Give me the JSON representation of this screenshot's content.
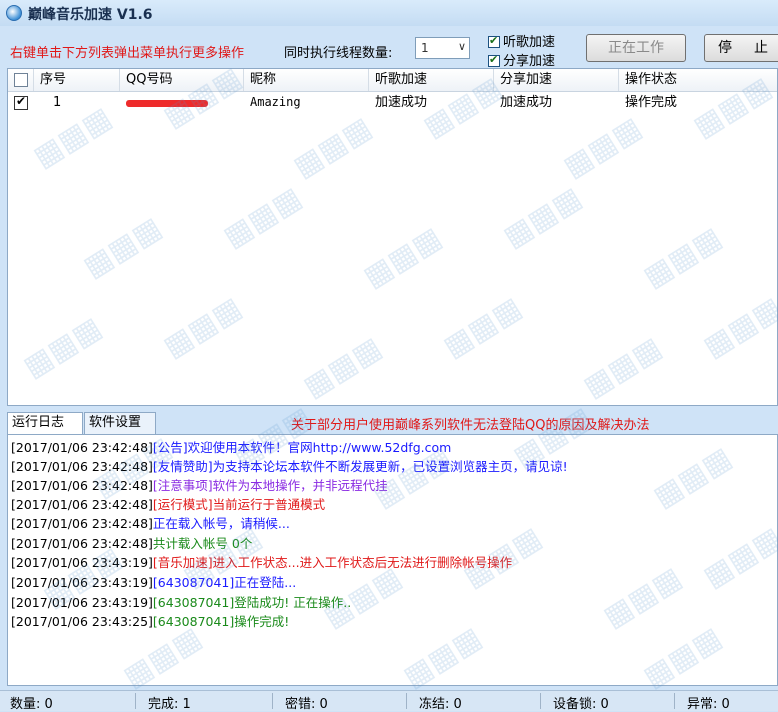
{
  "window": {
    "title": "巅峰音乐加速 V1.6"
  },
  "toolbar": {
    "hint": "右键单击下方列表弹出菜单执行更多操作",
    "threads_label": "同时执行线程数量:",
    "threads_value": "1",
    "listen_checkbox": "听歌加速",
    "share_checkbox": "分享加速",
    "working_button": "正在工作",
    "stop_button": "停止"
  },
  "table": {
    "columns": [
      "序号",
      "QQ号码",
      "昵称",
      "听歌加速",
      "分享加速",
      "操作状态"
    ],
    "rows": [
      {
        "index": "1",
        "nickname": "Amazing",
        "listen": "加速成功",
        "share": "加速成功",
        "status": "操作完成"
      }
    ]
  },
  "tabs": [
    "运行日志",
    "软件设置"
  ],
  "notice": "关于部分用户使用巅峰系列软件无法登陆QQ的原因及解决办法",
  "log": [
    {
      "time": "[2017/01/06 23:42:48]",
      "msg": "[公告]欢迎使用本软件！官网http://www.52dfg.com",
      "color": "#1a1aff"
    },
    {
      "time": "[2017/01/06 23:42:48]",
      "msg": "[友情赞助]为支持本论坛本软件不断发展更新，已设置浏览器主页，请见谅!",
      "color": "#1a1aff"
    },
    {
      "time": "[2017/01/06 23:42:48]",
      "msg": "[注意事项]软件为本地操作，并非远程代挂",
      "color": "#8a2be2"
    },
    {
      "time": "[2017/01/06 23:42:48]",
      "msg": "[运行模式]当前运行于普通模式",
      "color": "#e01818"
    },
    {
      "time": "[2017/01/06 23:42:48]",
      "msg": "正在载入帐号，请稍候...",
      "color": "#1a1aff"
    },
    {
      "time": "[2017/01/06 23:42:48]",
      "msg": "共计载入帐号 0个",
      "color": "#1a8a1a"
    },
    {
      "time": "[2017/01/06 23:43:19]",
      "msg": "[音乐加速]进入工作状态...进入工作状态后无法进行删除帐号操作",
      "color": "#e01818"
    },
    {
      "time": "[2017/01/06 23:43:19]",
      "msg": "[643087041]正在登陆...",
      "color": "#1a1aff"
    },
    {
      "time": "[2017/01/06 23:43:19]",
      "msg": "[643087041]登陆成功! 正在操作..",
      "color": "#1a8a1a"
    },
    {
      "time": "[2017/01/06 23:43:25]",
      "msg": "[643087041]操作完成!",
      "color": "#1a8a1a"
    }
  ],
  "status": {
    "count": "数量: 0",
    "done": "完成: 1",
    "pwd_error": "密错: 0",
    "frozen": "冻结: 0",
    "device_lock": "设备锁: 0",
    "abnormal": "异常: 0"
  },
  "colors": {
    "accent_red": "#e01818",
    "log_blue": "#1a1aff",
    "log_green": "#1a8a1a",
    "log_purple": "#8a2be2"
  }
}
